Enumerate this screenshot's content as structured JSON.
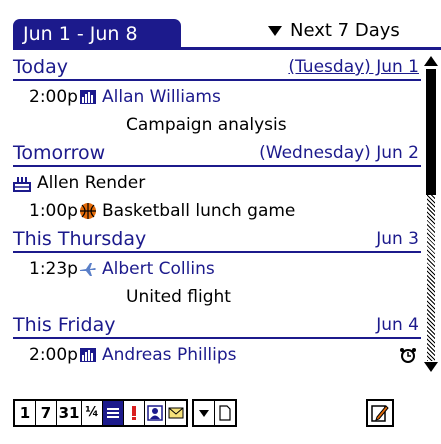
{
  "header": {
    "date_range": "Jun 1 - Jun 8",
    "range_picker": "Next 7 Days"
  },
  "days": [
    {
      "name": "Today",
      "date": "(Tuesday) Jun 1"
    },
    {
      "name": "Tomorrow",
      "date": "(Wednesday) Jun 2"
    },
    {
      "name": "This Thursday",
      "date": "Jun 3"
    },
    {
      "name": "This Friday",
      "date": "Jun 4"
    }
  ],
  "events": [
    {
      "time": "2:00p",
      "icon": "business-chart-icon",
      "title": "Allan Williams",
      "note": "Campaign analysis"
    },
    {
      "time": "",
      "icon": "birthday-cake-icon",
      "title": "Allen Render",
      "note": ""
    },
    {
      "time": "1:00p",
      "icon": "basketball-icon",
      "title": "Basketball lunch game",
      "note": ""
    },
    {
      "time": "1:23p",
      "icon": "airplane-icon",
      "title": "Albert Collins",
      "note": "United flight"
    },
    {
      "time": "2:00p",
      "icon": "business-chart-icon",
      "title": "Andreas Phillips",
      "note": "",
      "alarm_icon": "alarm-clock-icon"
    }
  ],
  "toolbar": {
    "buttons": [
      "1",
      "7",
      "31",
      "¼",
      "list-view-icon",
      "priority-icon",
      "contact-icon",
      "mail-icon",
      "dropdown-icon",
      "new-page-icon"
    ],
    "note_button": "note-pencil-icon"
  },
  "colors": {
    "accent": "#1c1a8c",
    "background": "#ffffff"
  }
}
